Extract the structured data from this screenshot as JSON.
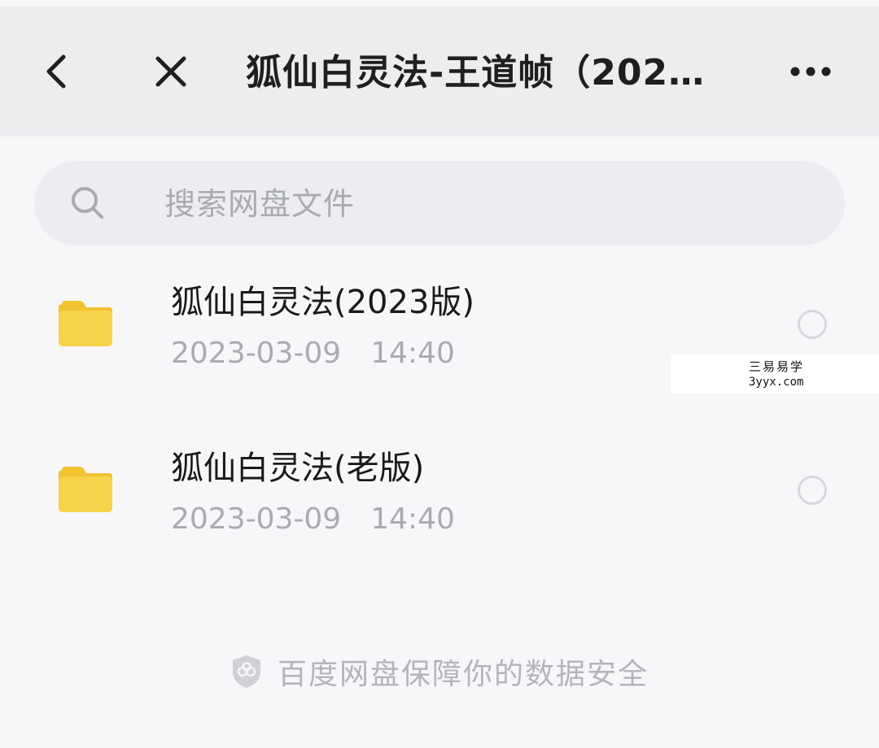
{
  "header": {
    "title": "狐仙白灵法-王道帧（202…",
    "back_icon": "chevron-left-icon",
    "close_icon": "close-icon",
    "more_icon": "more-horizontal-icon"
  },
  "search": {
    "placeholder": "搜索网盘文件",
    "value": "",
    "icon": "search-icon"
  },
  "files": [
    {
      "name": "狐仙白灵法(2023版)",
      "date": "2023-03-09",
      "time": "14:40",
      "icon": "folder-icon",
      "selected": false
    },
    {
      "name": "狐仙白灵法(老版)",
      "date": "2023-03-09",
      "time": "14:40",
      "icon": "folder-icon",
      "selected": false
    }
  ],
  "watermark": {
    "line1": "三易易学",
    "line2": "3yyx.com"
  },
  "footer": {
    "text": "百度网盘保障你的数据安全",
    "icon": "shield-icon"
  },
  "colors": {
    "folder": "#f7d34c",
    "folder_tab": "#f2c230",
    "header_bg": "#ededf0",
    "page_bg": "#f7f7f9",
    "secondary_text": "#a8abb2"
  }
}
